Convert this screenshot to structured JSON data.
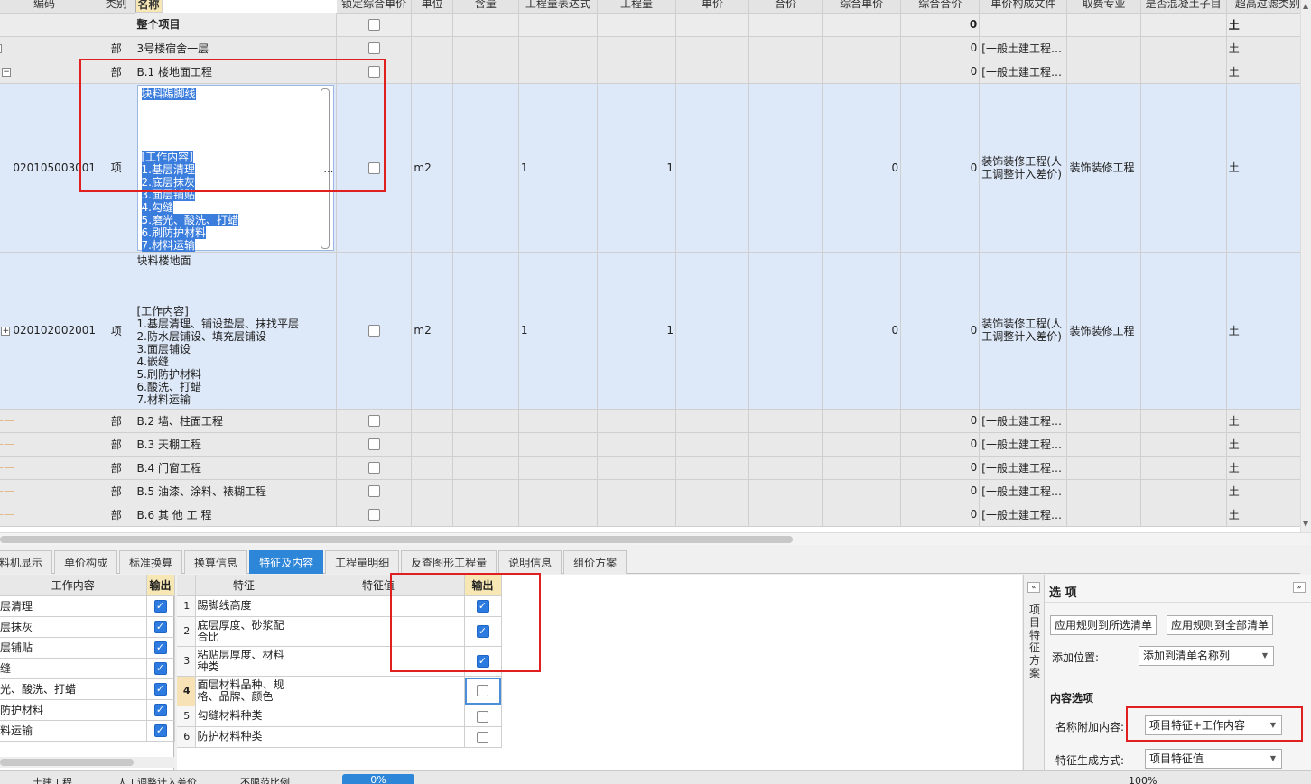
{
  "grid": {
    "columns": [
      "编码",
      "类别",
      "名称",
      "锁定综合单价",
      "单位",
      "含量",
      "工程量表达式",
      "工程量",
      "单价",
      "合价",
      "综合单价",
      "综合合价",
      "单价构成文件",
      "取费专业",
      "是否混凝土子目",
      "超高过滤类别"
    ],
    "total_row": {
      "name": "整个项目",
      "total": "0"
    },
    "row_floor": {
      "type": "部",
      "name": "3号楼宿舍一层",
      "total": "0",
      "file": "[一般土建工程…",
      "extra": "土"
    },
    "row_b1": {
      "type": "部",
      "name": "B.1  楼地面工程",
      "total": "0",
      "file": "[一般土建工程…",
      "extra": "土"
    },
    "item1": {
      "code": "020105003001",
      "type": "项",
      "unit": "m2",
      "expr": "1",
      "qty": "1",
      "unit_total": "0",
      "total": "0",
      "file": "装饰装修工程(人工调整计入差价)",
      "fee": "装饰装修工程",
      "extra": "土",
      "lines": [
        "块料踢脚线",
        "",
        "",
        "",
        "",
        "[工作内容]",
        "1.基层清理",
        "2.底层抹灰",
        "3.面层铺贴",
        "4.勾缝",
        "5.磨光、酸洗、打蜡",
        "6.刷防护材料",
        "7.材料运输"
      ]
    },
    "item2": {
      "code": "020102002001",
      "type": "项",
      "unit": "m2",
      "expr": "1",
      "qty": "1",
      "unit_total": "0",
      "total": "0",
      "file": "装饰装修工程(人工调整计入差价)",
      "fee": "装饰装修工程",
      "extra": "土",
      "lines": [
        "块料楼地面",
        "",
        "",
        "",
        "[工作内容]",
        "1.基层清理、铺设垫层、抹找平层",
        "2.防水层铺设、填充层铺设",
        "3.面层铺设",
        "4.嵌缝",
        "5.刷防护材料",
        "6.酸洗、打蜡",
        "7.材料运输"
      ]
    },
    "sections": [
      {
        "type": "部",
        "name": "B.2  墙、柱面工程",
        "total": "0",
        "file": "[一般土建工程…",
        "extra": "土"
      },
      {
        "type": "部",
        "name": "B.3  天棚工程",
        "total": "0",
        "file": "[一般土建工程…",
        "extra": "土"
      },
      {
        "type": "部",
        "name": "B.4  门窗工程",
        "total": "0",
        "file": "[一般土建工程…",
        "extra": "土"
      },
      {
        "type": "部",
        "name": "B.5  油漆、涂料、裱糊工程",
        "total": "0",
        "file": "[一般土建工程…",
        "extra": "土"
      },
      {
        "type": "部",
        "name": "B.6  其 他 工 程",
        "total": "0",
        "file": "[一般土建工程…",
        "extra": "土"
      }
    ]
  },
  "tabs": [
    "料机显示",
    "单价构成",
    "标准换算",
    "换算信息",
    "特征及内容",
    "工程量明细",
    "反查图形工程量",
    "说明信息",
    "组价方案"
  ],
  "active_tab": "特征及内容",
  "work_content": {
    "headers": [
      "工作内容",
      "输出"
    ],
    "rows": [
      "基层清理",
      "底层抹灰",
      "面层铺贴",
      "勾缝",
      "磨光、酸洗、打蜡",
      "刷防护材料",
      "材料运输"
    ]
  },
  "features": {
    "headers": [
      "特征",
      "特征值",
      "输出"
    ],
    "rows": [
      {
        "idx": "1",
        "name": "踢脚线高度",
        "checked": true
      },
      {
        "idx": "2",
        "name": "底层厚度、砂浆配合比",
        "checked": true
      },
      {
        "idx": "3",
        "name": "粘贴层厚度、材料种类",
        "checked": true
      },
      {
        "idx": "4",
        "name": "面层材料品种、规格、品牌、颜色",
        "checked": false
      },
      {
        "idx": "5",
        "name": "勾缝材料种类",
        "checked": false
      },
      {
        "idx": "6",
        "name": "防护材料种类",
        "checked": false
      }
    ]
  },
  "side_label": "项目特征方案",
  "options": {
    "title": "选 项",
    "btn_apply_selected": "应用规则到所选清单",
    "btn_apply_all": "应用规则到全部清单",
    "add_position_label": "添加位置:",
    "add_position_value": "添加到清单名称列",
    "content_section": "内容选项",
    "name_append_label": "名称附加内容:",
    "name_append_value": "项目特征+工作内容",
    "feature_mode_label": "特征生成方式:",
    "feature_mode_value": "项目特征值"
  },
  "status": {
    "item1": "土建工程",
    "item2": "人工调整计入差价",
    "item3": "不限范比例",
    "blue": "0%",
    "zoom": "100%"
  }
}
